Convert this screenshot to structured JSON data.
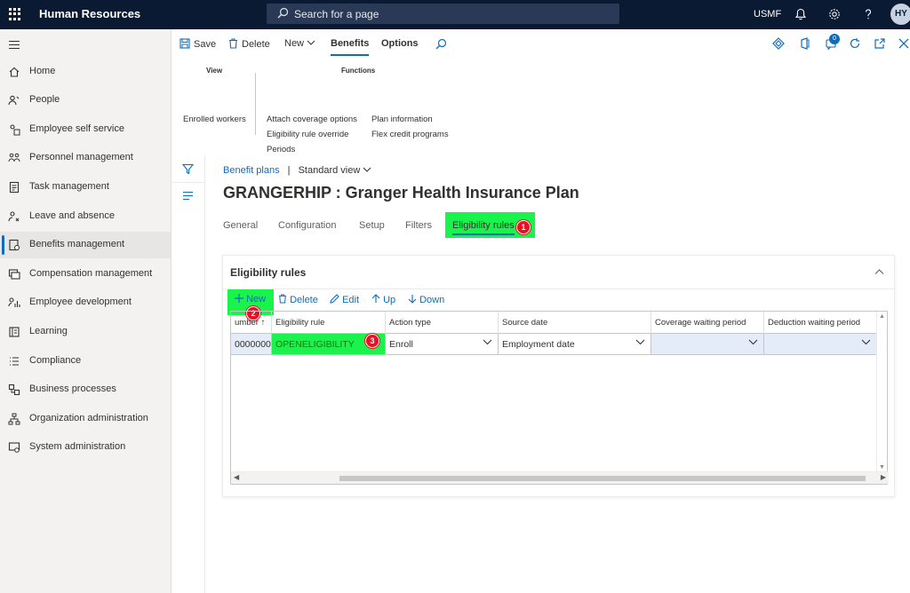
{
  "app": {
    "name": "Human Resources",
    "company": "USMF",
    "avatar_initials": "HY"
  },
  "search": {
    "placeholder": "Search for a page"
  },
  "nav": {
    "items": [
      {
        "label": "Home",
        "icon": "home-icon"
      },
      {
        "label": "People",
        "icon": "people-icon"
      },
      {
        "label": "Employee self service",
        "icon": "self-service-icon"
      },
      {
        "label": "Personnel management",
        "icon": "personnel-icon"
      },
      {
        "label": "Task management",
        "icon": "task-icon"
      },
      {
        "label": "Leave and absence",
        "icon": "leave-icon"
      },
      {
        "label": "Benefits management",
        "icon": "benefits-icon",
        "active": true
      },
      {
        "label": "Compensation management",
        "icon": "compensation-icon"
      },
      {
        "label": "Employee development",
        "icon": "development-icon"
      },
      {
        "label": "Learning",
        "icon": "learning-icon"
      },
      {
        "label": "Compliance",
        "icon": "compliance-icon"
      },
      {
        "label": "Business processes",
        "icon": "business-process-icon"
      },
      {
        "label": "Organization administration",
        "icon": "org-admin-icon"
      },
      {
        "label": "System administration",
        "icon": "system-admin-icon"
      }
    ]
  },
  "actionbar": {
    "save": "Save",
    "delete": "Delete",
    "new": "New",
    "tab_benefits": "Benefits",
    "tab_options": "Options",
    "notification_count": "0"
  },
  "ribbon": {
    "view_header": "View",
    "functions_header": "Functions",
    "view_links": [
      "Enrolled workers"
    ],
    "functions_col1": [
      "Attach coverage options",
      "Eligibility rule override",
      "Periods"
    ],
    "functions_col2": [
      "Plan information",
      "Flex credit programs"
    ]
  },
  "page": {
    "breadcrumb": "Benefit plans",
    "separator": "|",
    "view": "Standard view",
    "title": "GRANGERHIP : Granger Health Insurance Plan",
    "tabs": [
      "General",
      "Configuration",
      "Setup",
      "Filters",
      "Eligibility rules"
    ]
  },
  "card": {
    "title": "Eligibility rules",
    "buttons": {
      "new": "New",
      "delete": "Delete",
      "edit": "Edit",
      "up": "Up",
      "down": "Down"
    },
    "columns": [
      "umber",
      "Eligibility rule",
      "Action type",
      "Source date",
      "Coverage waiting period",
      "Deduction waiting period"
    ],
    "rows": [
      [
        "0000000",
        "OPENELIGIBILITY",
        "Enroll",
        "Employment date",
        "",
        ""
      ]
    ]
  },
  "annotations": [
    "1",
    "2",
    "3"
  ],
  "colors": {
    "highlight": "#1bf34d",
    "badge": "#e81123",
    "accent": "#0f6cbd",
    "topbar": "#0b1a33"
  }
}
